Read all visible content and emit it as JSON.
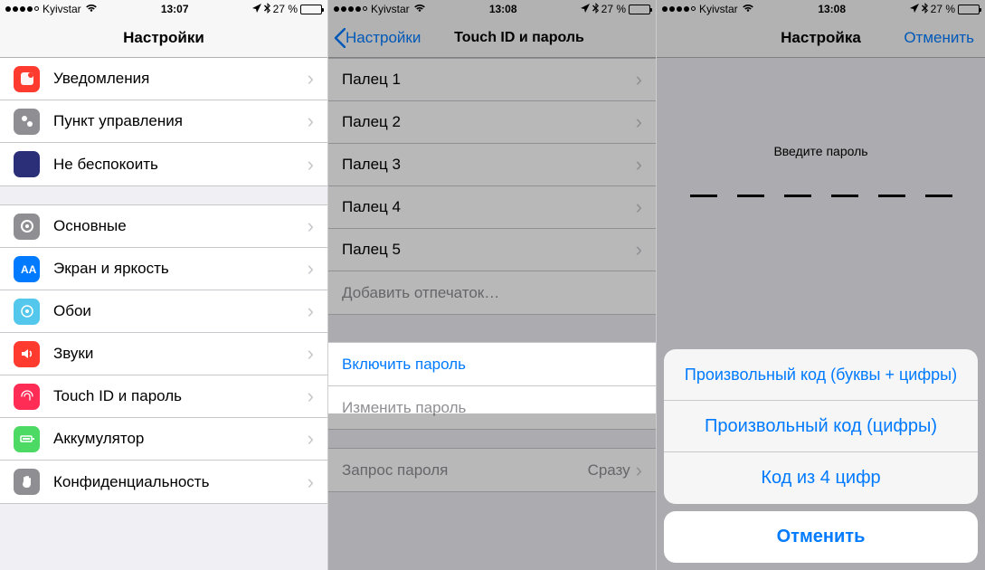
{
  "screen1": {
    "status": {
      "carrier": "Kyivstar",
      "time": "13:07",
      "battery": "27 %"
    },
    "nav": {
      "title": "Настройки"
    },
    "group1": [
      {
        "name": "notifications",
        "label": "Уведомления",
        "iconColor": "#ff3b30"
      },
      {
        "name": "control-center",
        "label": "Пункт управления",
        "iconColor": "#8e8e93"
      },
      {
        "name": "do-not-disturb",
        "label": "Не беспокоить",
        "iconColor": "#5856d6"
      }
    ],
    "group2": [
      {
        "name": "general",
        "label": "Основные",
        "iconColor": "#8e8e93"
      },
      {
        "name": "display",
        "label": "Экран и яркость",
        "iconColor": "#007aff"
      },
      {
        "name": "wallpaper",
        "label": "Обои",
        "iconColor": "#54c7ec"
      },
      {
        "name": "sounds",
        "label": "Звуки",
        "iconColor": "#ff3b30"
      },
      {
        "name": "touch-id",
        "label": "Touch ID и пароль",
        "iconColor": "#ff2d55"
      },
      {
        "name": "battery",
        "label": "Аккумулятор",
        "iconColor": "#4cd964"
      },
      {
        "name": "privacy",
        "label": "Конфиденциальность",
        "iconColor": "#8e8e93"
      }
    ]
  },
  "screen2": {
    "status": {
      "carrier": "Kyivstar",
      "time": "13:08",
      "battery": "27 %"
    },
    "nav": {
      "back": "Настройки",
      "title": "Touch ID и пароль"
    },
    "fingers": [
      {
        "label": "Палец 1"
      },
      {
        "label": "Палец 2"
      },
      {
        "label": "Палец 3"
      },
      {
        "label": "Палец 4"
      },
      {
        "label": "Палец 5"
      }
    ],
    "addFingerprint": "Добавить отпечаток…",
    "enablePasscode": "Включить пароль",
    "changePasscode": "Изменить пароль",
    "requirePasscode": {
      "label": "Запрос пароля",
      "value": "Сразу"
    }
  },
  "screen3": {
    "status": {
      "carrier": "Kyivstar",
      "time": "13:08",
      "battery": "27 %"
    },
    "nav": {
      "title": "Настройка",
      "cancel": "Отменить"
    },
    "prompt": "Введите пароль",
    "sheet": {
      "options": [
        "Произвольный код (буквы + цифры)",
        "Произвольный код (цифры)",
        "Код из 4 цифр"
      ],
      "cancel": "Отменить"
    }
  }
}
